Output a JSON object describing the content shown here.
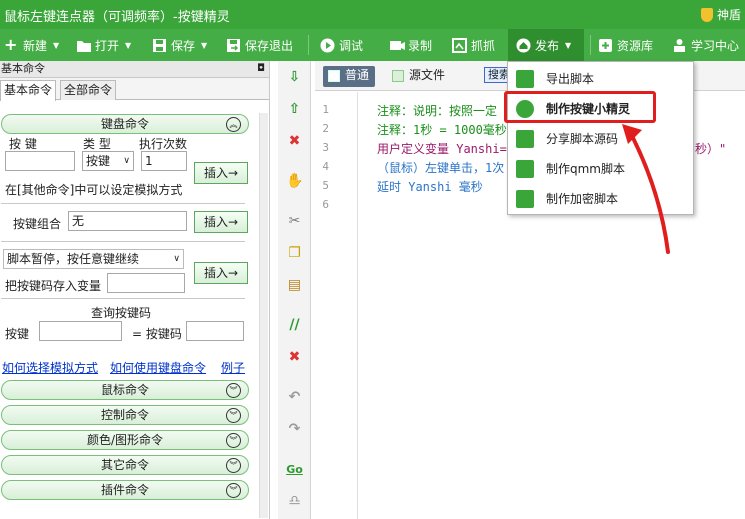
{
  "titlebar": {
    "title": "鼠标左键连点器（可调频率）-按键精灵",
    "user": "神盾"
  },
  "toolbar": {
    "new": "新建",
    "open": "打开",
    "save": "保存",
    "save_exit": "保存退出",
    "debug": "调试",
    "record": "录制",
    "capture": "抓抓",
    "publish": "发布",
    "resources": "资源库",
    "learning": "学习中心"
  },
  "left_panel": {
    "header": "基本命令",
    "pin": "ᵖ",
    "tabs": [
      "基本命令",
      "全部命令"
    ],
    "keyboard_section": "键盘命令",
    "col_key": "按 键",
    "col_type": "类 型",
    "col_count": "执行次数",
    "type_value": "按键",
    "count_value": "1",
    "insert": "插入→",
    "other_note": "在[其他命令]中可以设定模拟方式",
    "combo_label": "按键组合",
    "combo_value": "无",
    "pause_option": "脚本暂停，按任意键继续",
    "store_var": "把按键码存入变量",
    "query_title": "查询按键码",
    "query_key": "按键",
    "query_code": "= 按键码",
    "links": [
      "如何选择模拟方式",
      "如何使用键盘命令",
      "例子"
    ],
    "sections": [
      "鼠标命令",
      "控制命令",
      "颜色/图形命令",
      "其它命令",
      "插件命令"
    ]
  },
  "editor": {
    "tab_normal": "普通",
    "tab_source": "源文件",
    "search": "搜索",
    "line_numbers": [
      "1",
      "2",
      "3",
      "4",
      "5",
      "6"
    ],
    "lines": [
      {
        "text": "注释：说明：按照一定",
        "style": "comment"
      },
      {
        "text": "注释：1秒 = 1000毫秒",
        "style": "comment"
      },
      {
        "text": "用户定义变量 Yanshi=",
        "style": "purple"
      },
      {
        "text": "（鼠标）左键单击，1次",
        "style": "blue"
      },
      {
        "text": "延时 Yanshi 毫秒",
        "style": "blue"
      }
    ],
    "line3_tail": "秒）\""
  },
  "publish_menu": {
    "items": [
      "导出脚本",
      "制作按键小精灵",
      "分享脚本源码",
      "制作qmm脚本",
      "制作加密脚本"
    ],
    "highlighted_index": 1
  },
  "colors": {
    "titlebar": "#3aa63a",
    "toolbar": "#45ad45",
    "highlight_box": "#e01e1e"
  }
}
